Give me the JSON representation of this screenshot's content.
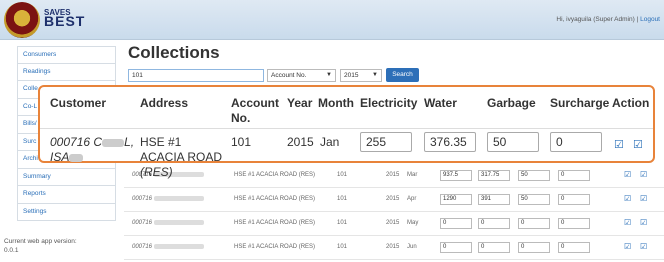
{
  "header": {
    "brand_top": "SAVES",
    "brand_bottom": "BEST",
    "greeting": "Hi, ivyaguila (Super Admin)",
    "separator": "|",
    "logout": "Logout"
  },
  "sidebar": {
    "items": [
      "Consumers",
      "Readings",
      "Colle",
      "Co-L",
      "Bills/",
      "Surc Undc",
      "Archive",
      "Summary",
      "Reports",
      "Settings"
    ],
    "version_label": "Current web app version:",
    "version": "0.0.1"
  },
  "main": {
    "title": "Collections",
    "search_value": "101",
    "filter_field": "Account No.",
    "filter_year": "2015",
    "search_button": "Search"
  },
  "zoom": {
    "headers": {
      "customer": "Customer",
      "address": "Address",
      "account": "Account No.",
      "year": "Year",
      "month": "Month",
      "electricity": "Electricity",
      "water": "Water",
      "garbage": "Garbage",
      "surcharge": "Surcharge",
      "action": "Action"
    },
    "row": {
      "customer_id": "000716",
      "customer_name_start": "C",
      "customer_name_end": "L,",
      "customer_line2": "ISA",
      "address": "HSE #1 ACACIA ROAD",
      "address_tag": "(RES)",
      "account": "101",
      "year": "2015",
      "month": "Jan",
      "electricity": "255",
      "water": "376.35",
      "garbage": "50",
      "surcharge": "0"
    }
  },
  "rows": [
    {
      "customer_id": "000716",
      "address": "HSE #1 ACACIA ROAD (RES)",
      "account": "101",
      "year": "2015",
      "month": "Mar",
      "electricity": "937.5",
      "water": "317.75",
      "garbage": "50",
      "surcharge": "0"
    },
    {
      "customer_id": "000716",
      "address": "HSE #1 ACACIA ROAD (RES)",
      "account": "101",
      "year": "2015",
      "month": "Apr",
      "electricity": "1290",
      "water": "391",
      "garbage": "50",
      "surcharge": "0"
    },
    {
      "customer_id": "000716",
      "address": "HSE #1 ACACIA ROAD (RES)",
      "account": "101",
      "year": "2015",
      "month": "May",
      "electricity": "0",
      "water": "0",
      "garbage": "0",
      "surcharge": "0"
    },
    {
      "customer_id": "000716",
      "address": "HSE #1 ACACIA ROAD (RES)",
      "account": "101",
      "year": "2015",
      "month": "Jun",
      "electricity": "0",
      "water": "0",
      "garbage": "0",
      "surcharge": "0"
    }
  ],
  "icons": {
    "edit": "edit-check-icon",
    "save": "save-check-icon"
  },
  "colors": {
    "accent": "#2d6fb8",
    "highlight": "#e8833a"
  }
}
